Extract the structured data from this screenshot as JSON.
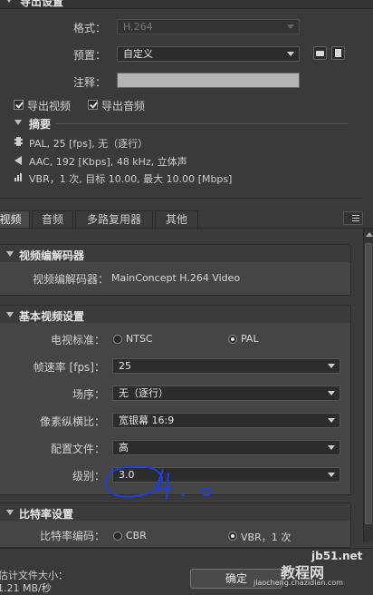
{
  "export_settings": {
    "header": "导出设置",
    "format_label": "格式：",
    "format_value": "H.264",
    "preset_label": "预置：",
    "preset_value": "自定义",
    "comment_label": "注释：",
    "comment_value": "",
    "export_video_label": "导出视频",
    "export_audio_label": "导出音频",
    "summary_label": "摘要",
    "summary_video": "PAL, 25 [fps], 无（逐行）",
    "summary_audio": "AAC, 192 [Kbps], 48 kHz, 立体声",
    "summary_bitrate": "VBR，1 次, 目标 10.00, 最大 10.00 [Mbps]"
  },
  "tabs": [
    {
      "label": "视频"
    },
    {
      "label": "音频"
    },
    {
      "label": "多路复用器"
    },
    {
      "label": "其他"
    }
  ],
  "video_codec": {
    "section_title": "视频编解码器",
    "codec_label": "视频编解码器：",
    "codec_value": "MainConcept H.264 Video"
  },
  "basic_video": {
    "section_title": "基本视频设置",
    "tv_standard_label": "电视标准：",
    "ntsc_label": "NTSC",
    "pal_label": "PAL",
    "frame_rate_label": "帧速率 [fps]：",
    "frame_rate_value": "25",
    "field_order_label": "场序：",
    "field_order_value": "无（逐行）",
    "pixel_aspect_label": "像素纵横比：",
    "pixel_aspect_value": "宽银幕 16:9",
    "profile_label": "配置文件：",
    "profile_value": "高",
    "level_label": "级别：",
    "level_value": "3.0"
  },
  "bitrate": {
    "section_title": "比特率设置",
    "encoding_label": "比特率编码：",
    "cbr_label": "CBR",
    "vbr_label": "VBR，1 次"
  },
  "footer": {
    "estimated_size_label": "估计文件大小：",
    "estimated_size_value": "1.21 MB/秒",
    "ok_label": "确定"
  },
  "annotation": {
    "handwriting": "4.0",
    "ink_color": "#1f3fd6"
  },
  "watermark": {
    "site": "jb51.net",
    "text": "教程网",
    "url": "jiaocheng.chazidian.com"
  }
}
